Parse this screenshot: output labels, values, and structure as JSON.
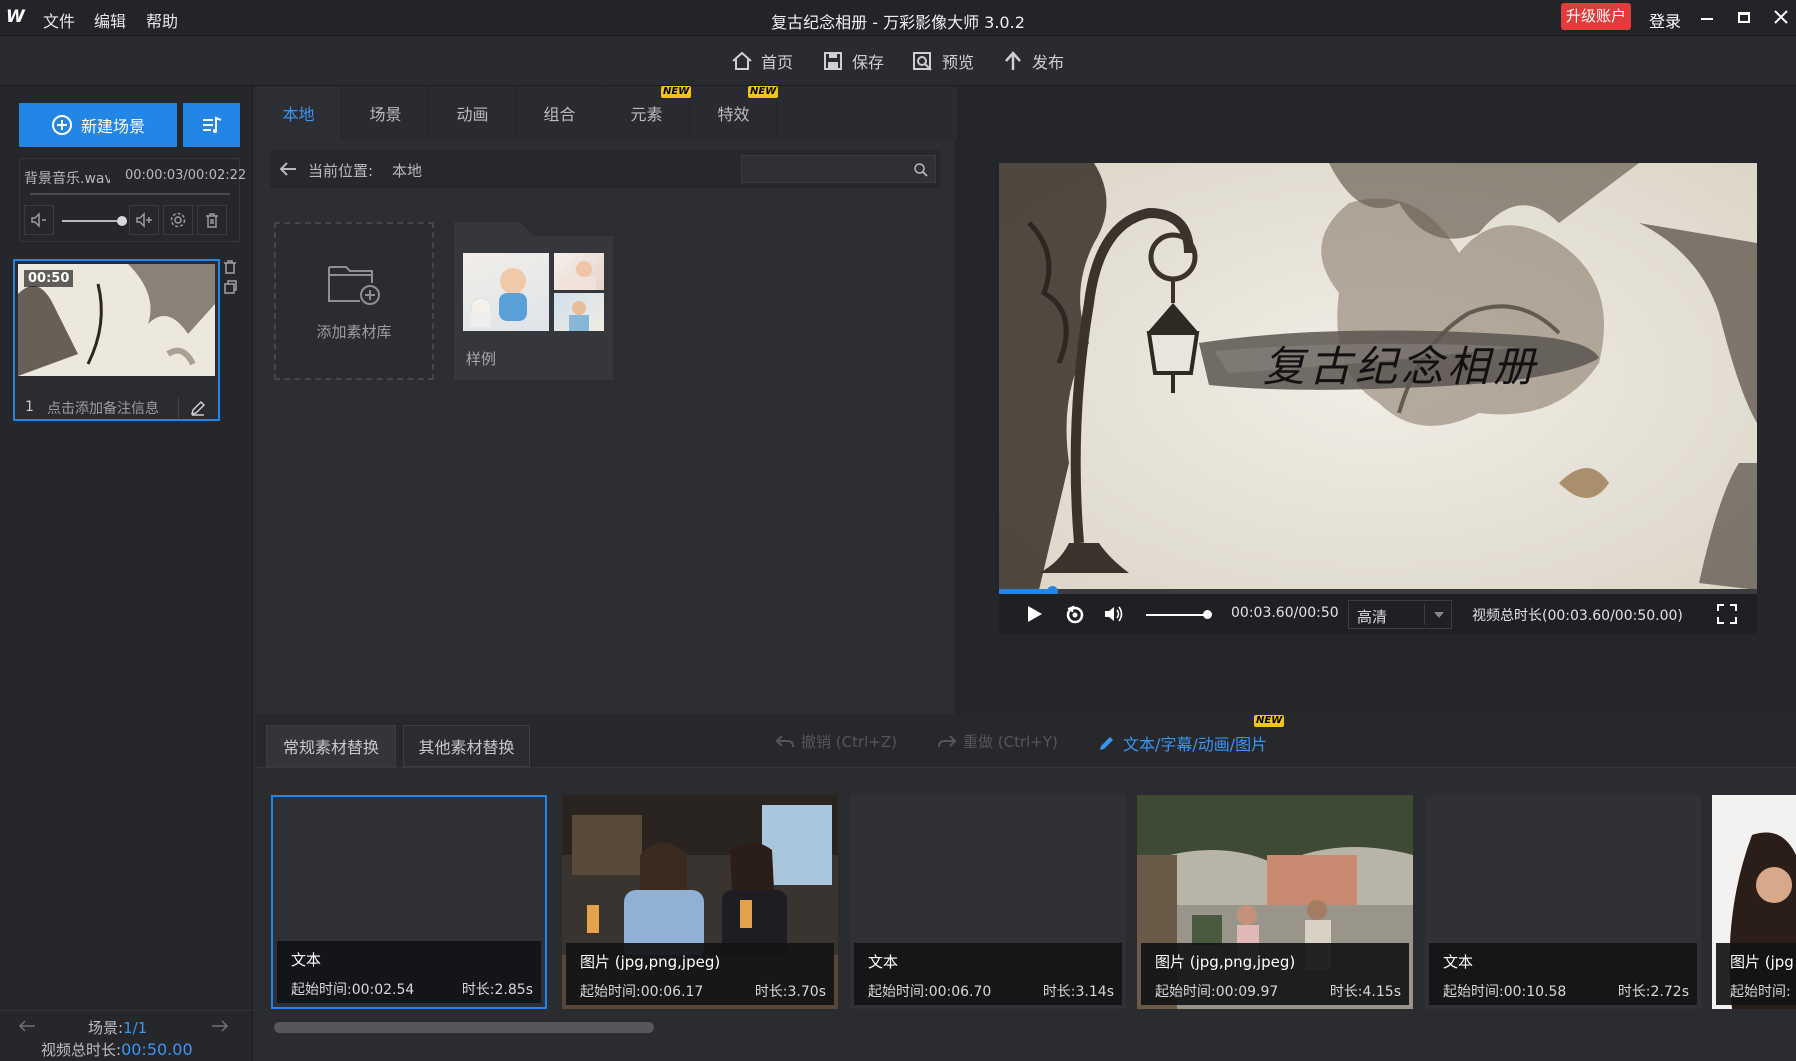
{
  "app": {
    "logo": "W",
    "title": "复古纪念相册 - 万彩影像大师 3.0.2",
    "menu": [
      "文件",
      "编辑",
      "帮助"
    ],
    "upgrade_label": "升级账户",
    "login_label": "登录"
  },
  "toolbar": {
    "home_label": "首页",
    "save_label": "保存",
    "preview_label": "预览",
    "publish_label": "发布"
  },
  "left": {
    "new_scene_label": "新建场景",
    "music_name": "背景音乐.wav",
    "music_time": "00:00:03/00:02:22",
    "scene": {
      "duration": "00:50",
      "index": "1",
      "note_placeholder": "点击添加备注信息"
    },
    "footer": {
      "scene_label": "场景:",
      "scene_value": "1/1",
      "total_label": "视频总时长:",
      "total_value": "00:50.00"
    }
  },
  "library": {
    "tabs": [
      {
        "label": "本地",
        "new": false
      },
      {
        "label": "场景",
        "new": false
      },
      {
        "label": "动画",
        "new": false
      },
      {
        "label": "组合",
        "new": false
      },
      {
        "label": "元素",
        "new": true
      },
      {
        "label": "特效",
        "new": true
      }
    ],
    "new_badge": "NEW",
    "path_label": "当前位置:",
    "path_value": "本地",
    "add_library_label": "添加素材库",
    "folder_label": "样例"
  },
  "preview": {
    "title_text": "复古纪念相册",
    "time_text": "00:03.60/00:50",
    "quality": "高清",
    "total_duration": "视频总时长(00:03.60/00:50.00)",
    "progress": 0.07
  },
  "bottom": {
    "tabs": [
      "常规素材替换",
      "其他素材替换"
    ],
    "undo_label": "撤销 (Ctrl+Z)",
    "redo_label": "重做 (Ctrl+Y)",
    "edit_label": "文本/字幕/动画/图片",
    "timeline": [
      {
        "type": "文本",
        "start": "起始时间:00:02.54",
        "duration": "时长:2.85s"
      },
      {
        "type": "图片 (jpg,png,jpeg)",
        "start": "起始时间:00:06.17",
        "duration": "时长:3.70s"
      },
      {
        "type": "文本",
        "start": "起始时间:00:06.70",
        "duration": "时长:3.14s"
      },
      {
        "type": "图片 (jpg,png,jpeg)",
        "start": "起始时间:00:09.97",
        "duration": "时长:4.15s"
      },
      {
        "type": "文本",
        "start": "起始时间:00:10.58",
        "duration": "时长:2.72s"
      },
      {
        "type": "图片 (jpg",
        "start": "起始时间:",
        "duration": ""
      }
    ]
  },
  "colors": {
    "accent": "#2386e6",
    "upgrade": "#e23b3b",
    "new_badge": "#f0c419"
  }
}
